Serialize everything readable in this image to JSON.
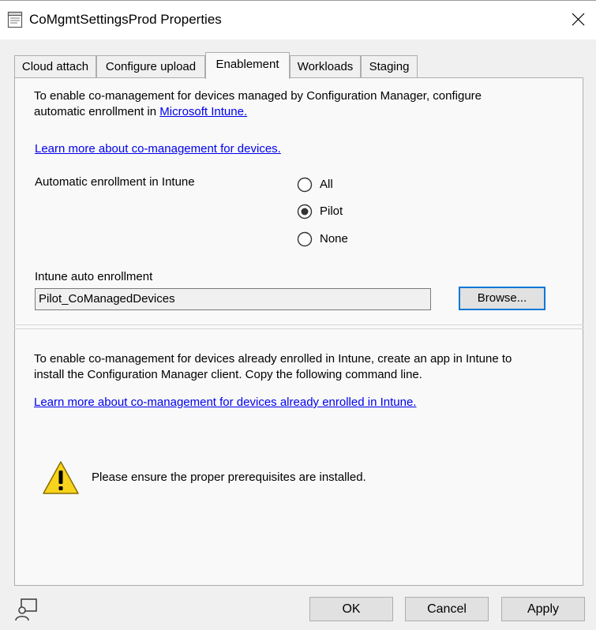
{
  "window": {
    "title": "CoMgmtSettingsProd Properties",
    "icon": "properties-sheet-icon",
    "close_icon": "close-icon"
  },
  "tabs": [
    {
      "label": "Cloud attach",
      "active": false
    },
    {
      "label": "Configure upload",
      "active": false
    },
    {
      "label": "Enablement",
      "active": true
    },
    {
      "label": "Workloads",
      "active": false
    },
    {
      "label": "Staging",
      "active": false
    }
  ],
  "enablement": {
    "intro_line1": "To enable co-management for devices managed by Configuration Manager, configure",
    "intro_line2_prefix": "automatic enrollment in ",
    "intro_link": "Microsoft Intune.",
    "learn_more_devices": "Learn more about co-management for devices.",
    "auto_enrollment_label": "Automatic enrollment in Intune",
    "radio_options": [
      {
        "label": "All",
        "selected": false
      },
      {
        "label": "Pilot",
        "selected": true
      },
      {
        "label": "None",
        "selected": false
      }
    ],
    "auto_enrollment_field_label": "Intune auto enrollment",
    "auto_enrollment_value": "Pilot_CoManagedDevices",
    "browse_label": "Browse...",
    "intune_line1": "To enable co-management for devices already enrolled in Intune, create an app in Intune to",
    "intune_line2": "install the Configuration Manager client. Copy the following command line.",
    "learn_more_intune": "Learn more about co-management for devices already enrolled in Intune.",
    "warning_text": "Please ensure the proper prerequisites are installed.",
    "warning_icon": "warning-icon"
  },
  "footer": {
    "feedback_icon": "feedback-icon",
    "ok_label": "OK",
    "cancel_label": "Cancel",
    "apply_label": "Apply"
  },
  "colors": {
    "link": "#0000ee",
    "focus_border": "#0078d7",
    "warning_yellow": "#f7d31c"
  }
}
